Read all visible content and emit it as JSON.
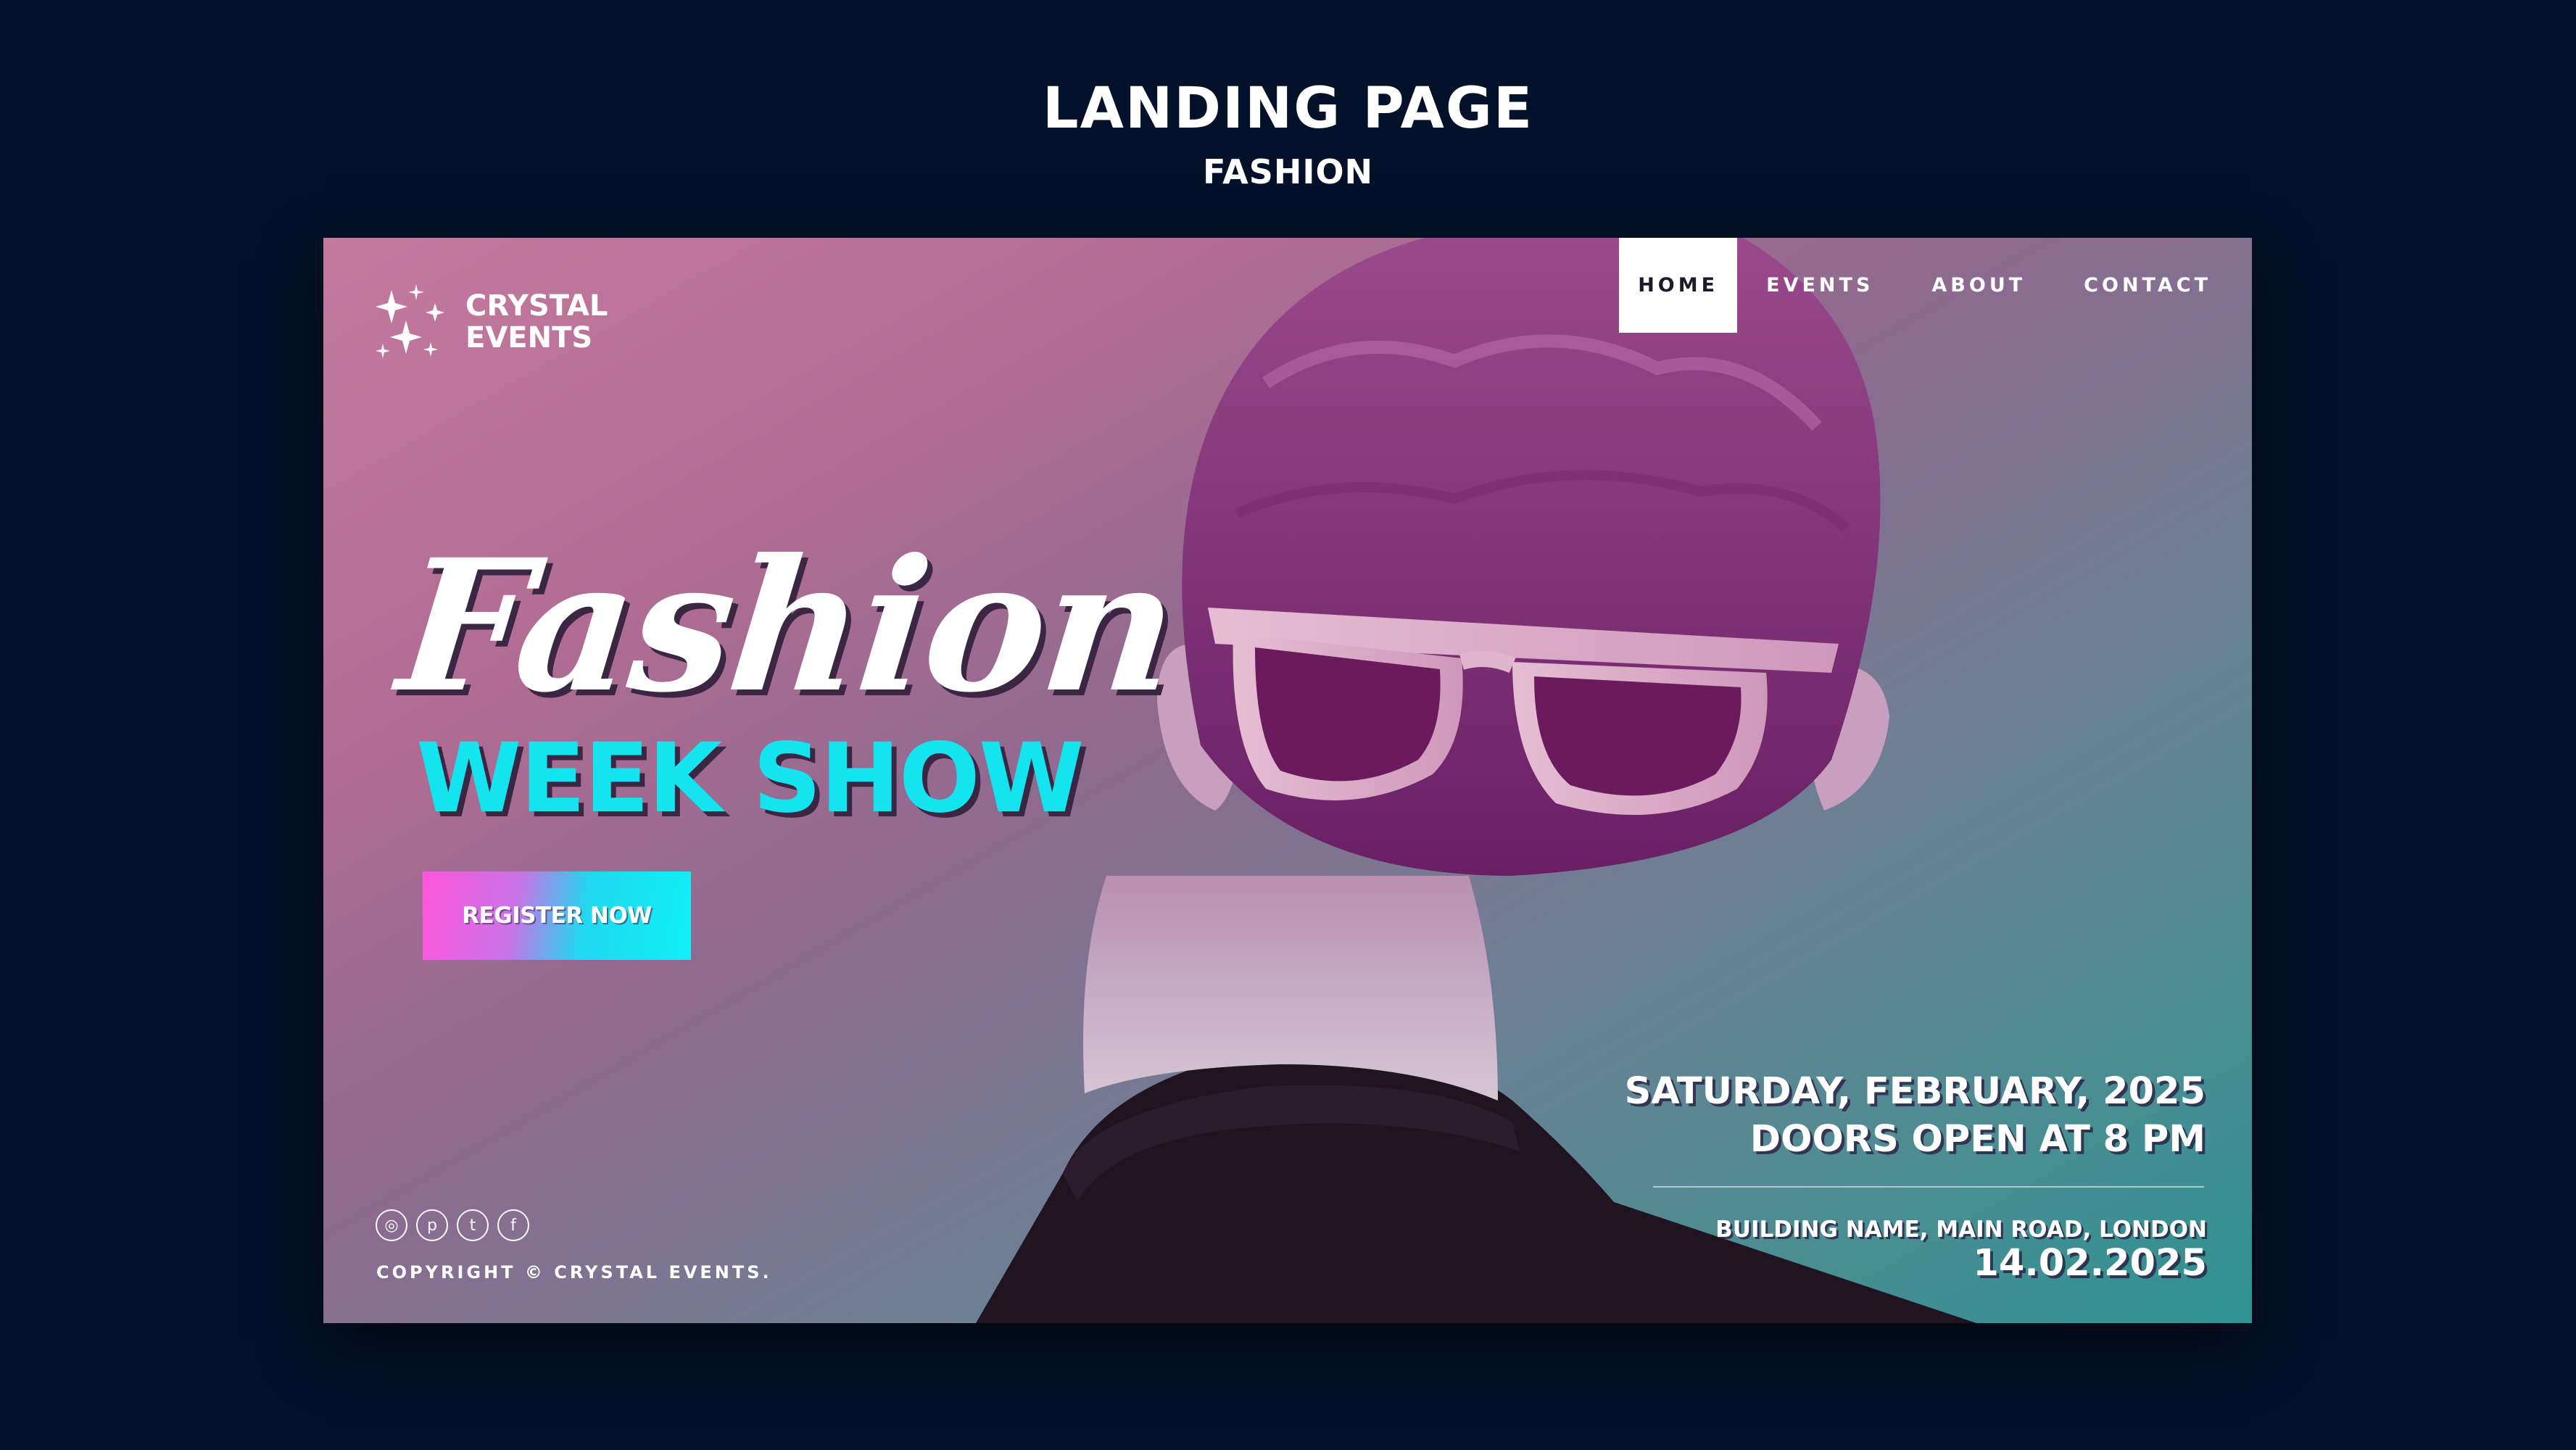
{
  "page": {
    "heading": "LANDING PAGE",
    "subheading": "FASHION"
  },
  "brand": {
    "line1": "CRYSTAL",
    "line2": "EVENTS",
    "icon": "sparkles-icon"
  },
  "nav": {
    "items": [
      {
        "label": "HOME",
        "active": true
      },
      {
        "label": "EVENTS",
        "active": false
      },
      {
        "label": "ABOUT",
        "active": false
      },
      {
        "label": "CONTACT",
        "active": false
      }
    ]
  },
  "hero": {
    "script_title": "Fashion",
    "title": "WEEK SHOW",
    "cta_label": "REGISTER NOW"
  },
  "event": {
    "date_line": "SATURDAY, FEBRUARY, 2025",
    "doors_line": "DOORS OPEN AT 8 PM",
    "address": "BUILDING NAME, MAIN ROAD, LONDON",
    "short_date": "14.02.2025"
  },
  "footer": {
    "socials": [
      "instagram-icon",
      "pinterest-icon",
      "tumblr-icon",
      "facebook-icon"
    ],
    "social_glyphs": [
      "◎",
      "p",
      "t",
      "f"
    ],
    "copyright": "COPYRIGHT © CRYSTAL EVENTS."
  },
  "colors": {
    "background": "#03122a",
    "accent_cyan": "#14e4ef",
    "accent_pink": "#ff55dd",
    "nav_active_bg": "#ffffff"
  }
}
